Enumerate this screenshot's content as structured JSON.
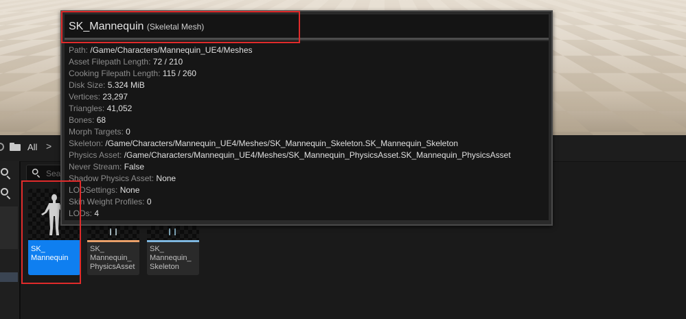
{
  "breadcrumb": {
    "root_label": "All",
    "separator": ">"
  },
  "search": {
    "placeholder": "Search"
  },
  "assets": [
    {
      "name": "SK_\nMannequin",
      "stripe_color": "#0f7ff0",
      "selected": true
    },
    {
      "name": "SK_\nMannequin_\nPhysicsAsset",
      "stripe_color": "#e9a06a",
      "selected": false
    },
    {
      "name": "SK_\nMannequin_\nSkeleton",
      "stripe_color": "#7fb7e0",
      "selected": false
    }
  ],
  "tooltip": {
    "title": "SK_Mannequin",
    "type": "(Skeletal Mesh)",
    "props": [
      {
        "key": "Path:",
        "value": "/Game/Characters/Mannequin_UE4/Meshes"
      },
      {
        "key": "Asset Filepath Length:",
        "value": "72 / 210"
      },
      {
        "key": "Cooking Filepath Length:",
        "value": "115 / 260"
      },
      {
        "key": "Disk Size:",
        "value": "5.324 MiB"
      },
      {
        "key": "Vertices:",
        "value": "23,297"
      },
      {
        "key": "Triangles:",
        "value": "41,052"
      },
      {
        "key": "Bones:",
        "value": "68"
      },
      {
        "key": "Morph Targets:",
        "value": "0"
      },
      {
        "key": "Skeleton:",
        "value": "/Game/Characters/Mannequin_UE4/Meshes/SK_Mannequin_Skeleton.SK_Mannequin_Skeleton"
      },
      {
        "key": "Physics Asset:",
        "value": "/Game/Characters/Mannequin_UE4/Meshes/SK_Mannequin_PhysicsAsset.SK_Mannequin_PhysicsAsset"
      },
      {
        "key": "Never Stream:",
        "value": "False"
      },
      {
        "key": "Shadow Physics Asset:",
        "value": "None"
      },
      {
        "key": "LODSettings:",
        "value": "None"
      },
      {
        "key": "Skin Weight Profiles:",
        "value": "0"
      },
      {
        "key": "LODs:",
        "value": "4"
      }
    ]
  },
  "colors": {
    "highlight": "#e12b2b",
    "selection": "#0f7ff0"
  }
}
